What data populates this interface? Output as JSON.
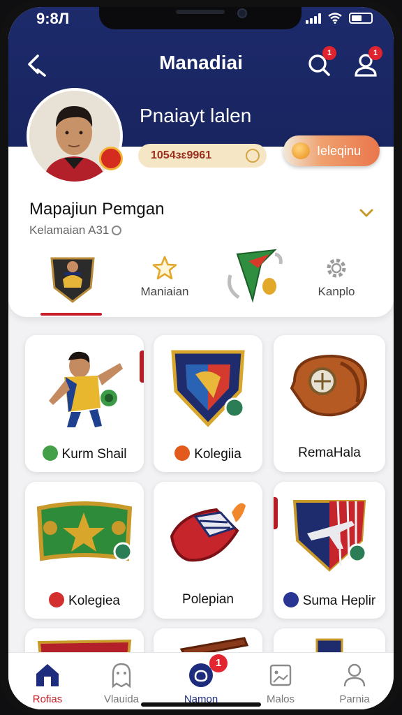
{
  "status_bar": {
    "time": "9:8Л"
  },
  "header": {
    "title": "Manadiai",
    "search_badge": "1",
    "profile_badge": "1"
  },
  "profile": {
    "player_name": "Pnaiayt lalen",
    "id_value": "1054ᴈɛ9961",
    "action_label": "Ieleqinu"
  },
  "section": {
    "title": "Mapajiun Pemgan",
    "subtitle": "Kelamaian A31"
  },
  "tabs": [
    {
      "label": "",
      "icon": "player-shield-icon"
    },
    {
      "label": "Maniaian",
      "icon": "star-icon"
    },
    {
      "label": "",
      "icon": "green-pennant-icon"
    },
    {
      "label": "Kanplo",
      "icon": "gear-icon"
    }
  ],
  "grid_items": [
    {
      "label": "Kurm Shail",
      "icon": "player-figure-icon",
      "dot_color": "#43a047"
    },
    {
      "label": "Kolegiia",
      "icon": "shield-crest-icon",
      "dot_color": "#e25a1c"
    },
    {
      "label": "RemaHala",
      "icon": "leather-ball-icon"
    },
    {
      "label": "Kolegiea",
      "icon": "green-plaque-icon",
      "dot_color": "#d32f2f"
    },
    {
      "label": "Polepian",
      "icon": "red-scarf-icon"
    },
    {
      "label": "Suma Heplir",
      "icon": "plane-shield-icon",
      "dot_color": "#283593"
    },
    {
      "label": "",
      "icon": "banner-icon"
    },
    {
      "label": "",
      "icon": "scarf-icon"
    },
    {
      "label": "",
      "icon": "crest-icon"
    }
  ],
  "tabbar": [
    {
      "label": "Rofias",
      "icon": "home-icon",
      "active": true
    },
    {
      "label": "Vlauida",
      "icon": "ghost-icon"
    },
    {
      "label": "Namon",
      "icon": "shield-circle-icon",
      "badge": "1"
    },
    {
      "label": "Malos",
      "icon": "photo-icon"
    },
    {
      "label": "Parnia",
      "icon": "person-icon"
    }
  ],
  "colors": {
    "header_bg": "#1d2a6b",
    "accent_red": "#c8202a",
    "action_orange": "#e9774c"
  }
}
